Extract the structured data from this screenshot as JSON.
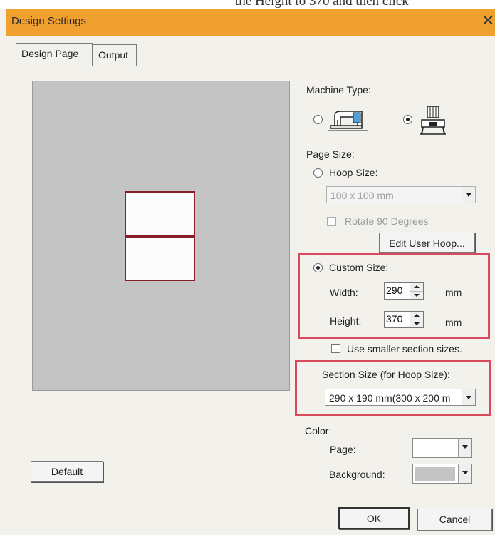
{
  "top_text": "the Height to 370 and then click",
  "window": {
    "title": "Design Settings",
    "close_glyph": "✕"
  },
  "tabs": [
    {
      "label": "Design Page"
    },
    {
      "label": "Output"
    }
  ],
  "machine_type": {
    "label": "Machine Type:",
    "options": [
      {
        "icon": "sewing-machine-icon",
        "selected": false
      },
      {
        "icon": "embroidery-machine-icon",
        "selected": true
      }
    ]
  },
  "page_size": {
    "label": "Page Size:",
    "hoop_size": {
      "label": "Hoop Size:",
      "value": "100 x 100 mm",
      "selected": false
    },
    "rotate_label": "Rotate 90 Degrees",
    "edit_user_hoop_label": "Edit User Hoop..."
  },
  "custom_size": {
    "label": "Custom Size:",
    "selected": true,
    "width_label": "Width:",
    "width_value": "290",
    "height_label": "Height:",
    "height_value": "370",
    "unit": "mm"
  },
  "smaller_sections_label": "Use smaller section sizes.",
  "section_size": {
    "label": "Section Size (for Hoop Size):",
    "value": "290 x 190 mm(300 x 200 m"
  },
  "color": {
    "label": "Color:",
    "page_label": "Page:",
    "page_color": "#ffffff",
    "background_label": "Background:",
    "background_color": "#c4c4c4"
  },
  "buttons": {
    "default": "Default",
    "ok": "OK",
    "cancel": "Cancel"
  },
  "colors": {
    "title_bar": "#f0a02e",
    "highlight": "#d8485e",
    "section_outline": "#8b1d2a"
  }
}
